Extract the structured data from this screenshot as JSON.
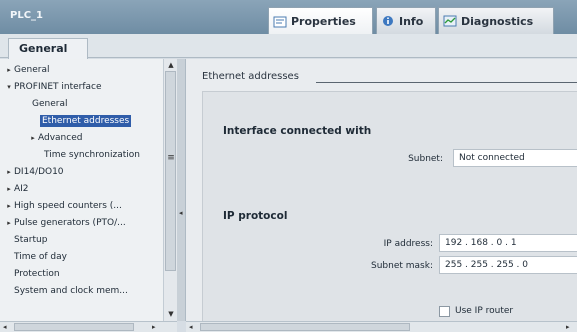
{
  "window": {
    "title": "PLC_1"
  },
  "tabs": [
    {
      "label": "Properties",
      "icon": "properties-icon",
      "active": true
    },
    {
      "label": "Info",
      "icon": "info-icon",
      "active": false
    },
    {
      "label": "Diagnostics",
      "icon": "diagnostics-icon",
      "active": false
    }
  ],
  "subtab": {
    "label": "General"
  },
  "nav": {
    "items": [
      {
        "label": "General",
        "arrow": "▸"
      },
      {
        "label": "PROFINET interface",
        "arrow": "▾"
      },
      {
        "label": "General",
        "arrow": ""
      },
      {
        "label": "Ethernet addresses",
        "arrow": "",
        "selected": true
      },
      {
        "label": "Advanced",
        "arrow": "▸"
      },
      {
        "label": "Time synchronization",
        "arrow": ""
      },
      {
        "label": "DI14/DO10",
        "arrow": "▸"
      },
      {
        "label": "AI2",
        "arrow": "▸"
      },
      {
        "label": "High speed counters (...",
        "arrow": "▸"
      },
      {
        "label": "Pulse generators (PTO/...",
        "arrow": "▸"
      },
      {
        "label": "Startup",
        "arrow": ""
      },
      {
        "label": "Time of day",
        "arrow": ""
      },
      {
        "label": "Protection",
        "arrow": ""
      },
      {
        "label": "System and clock mem...",
        "arrow": ""
      }
    ]
  },
  "content": {
    "section_title": "Ethernet addresses",
    "interface": {
      "title": "Interface connected with",
      "subnet_label": "Subnet:",
      "subnet_value": "Not connected"
    },
    "ip": {
      "title": "IP protocol",
      "ip_label": "IP address:",
      "ip_value": "192 . 168 . 0     . 1",
      "mask_label": "Subnet mask:",
      "mask_value": "255 . 255 . 255 . 0",
      "router_label": "Use IP router"
    }
  },
  "colors": {
    "selection": "#2f5da9",
    "titlebar": "#7f99ae",
    "panel": "#dfe3e7"
  }
}
